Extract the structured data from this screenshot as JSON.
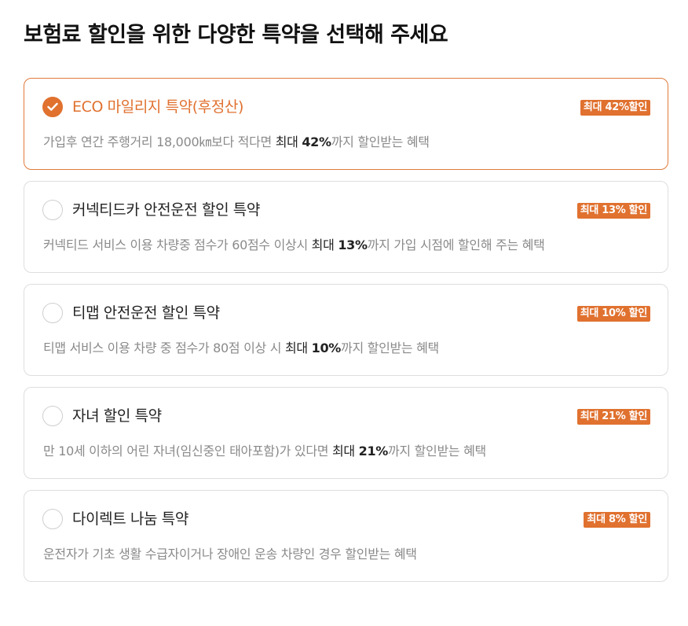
{
  "page_title": "보험료 할인을 위한 다양한 특약을 선택해 주세요",
  "accent_color": "#e0712f",
  "options": [
    {
      "title": "ECO 마일리지 특약(후정산)",
      "badge": "최대 42%할인",
      "selected": true,
      "desc_pre": "가입후 연간 주행거리 18,000㎞보다 적다면 ",
      "desc_mid": "최대 ",
      "desc_strong": "42%",
      "desc_post": "까지 할인받는 혜택"
    },
    {
      "title": "커넥티드카 안전운전 할인 특약",
      "badge": "최대 13% 할인",
      "selected": false,
      "desc_pre": "커넥티드 서비스 이용 차량중 점수가 60점수 이상시 ",
      "desc_mid": "최대 ",
      "desc_strong": "13%",
      "desc_post": "까지 가입 시점에 할인해 주는 혜택"
    },
    {
      "title": "티맵 안전운전 할인 특약",
      "badge": "최대 10% 할인",
      "selected": false,
      "desc_pre": "티맵 서비스 이용 차량 중 점수가 80점 이상 시 ",
      "desc_mid": "최대 ",
      "desc_strong": "10%",
      "desc_post": "까지 할인받는 혜택"
    },
    {
      "title": "자녀 할인 특약",
      "badge": "최대 21% 할인",
      "selected": false,
      "desc_pre": "만 10세 이하의 어린 자녀(임신중인 태아포함)가 있다면 ",
      "desc_mid": "최대 ",
      "desc_strong": "21%",
      "desc_post": "까지 할인받는 혜택"
    },
    {
      "title": "다이렉트 나눔 특약",
      "badge": "최대 8% 할인",
      "selected": false,
      "desc_pre": "운전자가 기초 생활 수급자이거나 장애인 운송 차량인 경우 할인받는 혜택",
      "desc_mid": "",
      "desc_strong": "",
      "desc_post": ""
    }
  ]
}
